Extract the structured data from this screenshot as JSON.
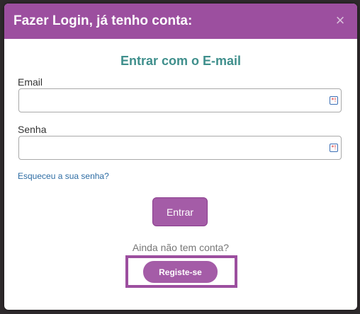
{
  "modal": {
    "title": "Fazer Login, já tenho conta:",
    "close_icon": "×"
  },
  "form": {
    "section_title": "Entrar com o E-mail",
    "email_label": "Email",
    "email_value": "",
    "password_label": "Senha",
    "password_value": "",
    "forgot_link": "Esqueceu a sua senha?",
    "submit_label": "Entrar",
    "key_icon": "password-manager-icon"
  },
  "register": {
    "prompt": "Ainda não tem conta?",
    "button_label": "Registe-se"
  },
  "colors": {
    "header": "#9c4f9f",
    "button": "#a45ca7",
    "title_accent": "#3f8f8c",
    "link": "#2e6da4"
  }
}
